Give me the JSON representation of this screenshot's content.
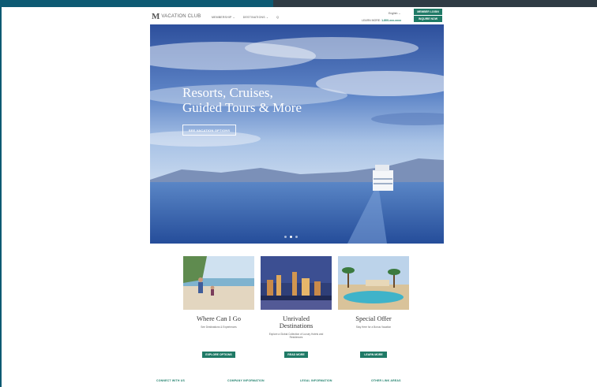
{
  "header": {
    "logo_mark": "M",
    "logo_text": "VACATION CLUB",
    "nav": [
      "MEMBERSHIP ⌄",
      "DESTINATIONS ⌄",
      "Q"
    ],
    "language": "English ⌄",
    "phone_prefix": "LEARN MORE:",
    "phone_number": "1-800-xxx-xxxx",
    "buttons": [
      "MEMBER LOGIN",
      "INQUIRE NOW"
    ]
  },
  "hero": {
    "title": "Resorts, Cruises,\nGuided Tours & More",
    "button": "SEE VACATION OPTIONS",
    "slides": 3,
    "active_slide": 2
  },
  "cards": [
    {
      "title": "Where Can I Go",
      "description": "See Destinations & Experiences",
      "button": "EXPLORE OPTIONS"
    },
    {
      "title": "Unrivaled\nDestinations",
      "description": "Explore a Global Collection of Luxury Hotels and Residences",
      "button": "READ MORE"
    },
    {
      "title": "Special Offer",
      "description": "Stay Here for a Bonus Vacation",
      "button": "LEARN MORE"
    }
  ],
  "footer": [
    "CONNECT WITH US",
    "COMPANY INFORMATION",
    "LEGAL INFORMATION",
    "OTHER LINK AREAS"
  ],
  "colors": {
    "brand_green": "#1f7a66",
    "top_bar": "#0d5a73"
  }
}
